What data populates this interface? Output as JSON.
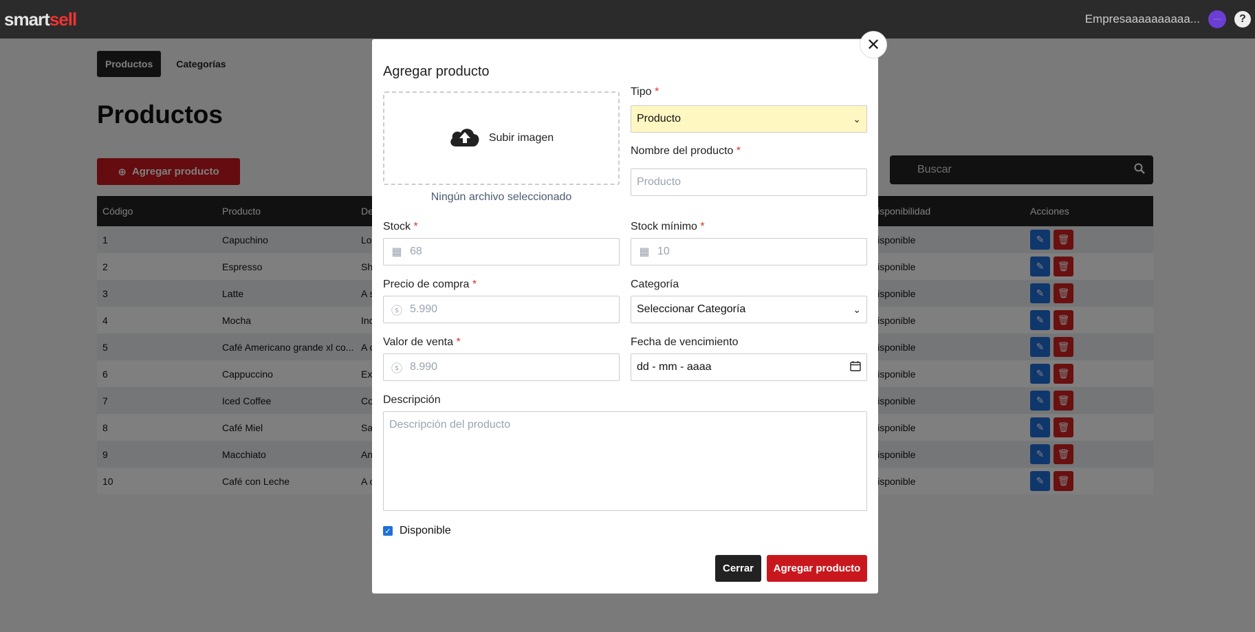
{
  "app": {
    "logo_part1": "smart",
    "logo_part2": "sell",
    "company": "Empresaaaaaaaaaa...",
    "help": "?"
  },
  "tabs": [
    {
      "label": "Productos"
    },
    {
      "label": "Categorías"
    }
  ],
  "page": {
    "title": "Productos",
    "add_button": "Agregar producto",
    "search_placeholder": "Buscar"
  },
  "table": {
    "headers": [
      "Código",
      "Producto",
      "De",
      "Disponibilidad",
      "Acciones"
    ],
    "rows": [
      {
        "code": "1",
        "product": "Capuchino",
        "desc": "Lo",
        "availability": "Disponible"
      },
      {
        "code": "2",
        "product": "Espresso",
        "desc": "Sh",
        "availability": "Disponible"
      },
      {
        "code": "3",
        "product": "Latte",
        "desc": "A s",
        "availability": "Disponible"
      },
      {
        "code": "4",
        "product": "Mocha",
        "desc": "Inc",
        "availability": "Disponible"
      },
      {
        "code": "5",
        "product": "Café Americano grande xl co...",
        "desc": "A c",
        "availability": "Disponible"
      },
      {
        "code": "6",
        "product": "Cappuccino",
        "desc": "Exp",
        "availability": "Disponible"
      },
      {
        "code": "7",
        "product": "Iced Coffee",
        "desc": "Co",
        "availability": "Disponible"
      },
      {
        "code": "8",
        "product": "Café Miel",
        "desc": "Sa",
        "availability": "Disponible"
      },
      {
        "code": "9",
        "product": "Macchiato",
        "desc": "An",
        "availability": "Disponible"
      },
      {
        "code": "10",
        "product": "Café con Leche",
        "desc": "A c",
        "availability": "Disponible"
      }
    ]
  },
  "modal": {
    "title": "Agregar producto",
    "upload_label": "Subir imagen",
    "no_file": "Ningún archivo seleccionado",
    "tipo": {
      "label": "Tipo",
      "value": "Producto"
    },
    "nombre": {
      "label": "Nombre del producto",
      "placeholder": "Producto"
    },
    "stock": {
      "label": "Stock",
      "placeholder": "68"
    },
    "stock_min": {
      "label": "Stock mínimo",
      "placeholder": "10"
    },
    "precio_compra": {
      "label": "Precio de compra",
      "placeholder": "5.990"
    },
    "categoria": {
      "label": "Categoría",
      "value": "Seleccionar Categoría"
    },
    "valor_venta": {
      "label": "Valor de venta",
      "placeholder": "8.990"
    },
    "fecha": {
      "label": "Fecha de vencimiento",
      "value": "dd - mm - aaaa"
    },
    "descripcion": {
      "label": "Descripción",
      "placeholder": "Descripción del producto"
    },
    "disponible": {
      "label": "Disponible",
      "checked": true
    },
    "required_mark": "*",
    "close_button": "Cerrar",
    "submit_button": "Agregar producto"
  },
  "colors": {
    "primary": "#c8181e",
    "dark": "#222222",
    "edit": "#1e6fd9",
    "delete": "#d32020"
  }
}
